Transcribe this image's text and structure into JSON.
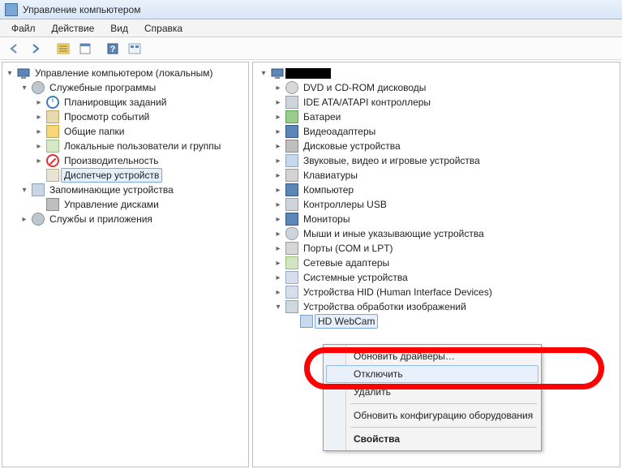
{
  "window": {
    "title": "Управление компьютером"
  },
  "menubar": [
    "Файл",
    "Действие",
    "Вид",
    "Справка"
  ],
  "left_tree": {
    "root": {
      "label": "Управление компьютером (локальным)"
    },
    "groups": [
      {
        "label": "Служебные программы",
        "expanded": true,
        "children": [
          {
            "label": "Планировщик заданий",
            "icon": "clock"
          },
          {
            "label": "Просмотр событий",
            "icon": "event"
          },
          {
            "label": "Общие папки",
            "icon": "share"
          },
          {
            "label": "Локальные пользователи и группы",
            "icon": "users"
          },
          {
            "label": "Производительность",
            "icon": "no"
          },
          {
            "label": "Диспетчер устройств",
            "icon": "dev",
            "selected": true
          }
        ]
      },
      {
        "label": "Запоминающие устройства",
        "expanded": true,
        "children": [
          {
            "label": "Управление дисками",
            "icon": "disk"
          }
        ]
      },
      {
        "label": "Службы и приложения",
        "expanded": false
      }
    ]
  },
  "right_tree": {
    "categories": [
      {
        "label": "DVD и CD-ROM дисководы",
        "icon": "cd"
      },
      {
        "label": "IDE ATA/ATAPI контроллеры",
        "icon": "chip"
      },
      {
        "label": "Батареи",
        "icon": "bat"
      },
      {
        "label": "Видеоадаптеры",
        "icon": "mon"
      },
      {
        "label": "Дисковые устройства",
        "icon": "disk"
      },
      {
        "label": "Звуковые, видео и игровые устройства",
        "icon": "aud"
      },
      {
        "label": "Клавиатуры",
        "icon": "kb"
      },
      {
        "label": "Компьютер",
        "icon": "mon"
      },
      {
        "label": "Контроллеры USB",
        "icon": "usb"
      },
      {
        "label": "Мониторы",
        "icon": "mon"
      },
      {
        "label": "Мыши и иные указывающие устройства",
        "icon": "mouse"
      },
      {
        "label": "Порты (COM и LPT)",
        "icon": "port"
      },
      {
        "label": "Сетевые адаптеры",
        "icon": "net"
      },
      {
        "label": "Системные устройства",
        "icon": "sys"
      },
      {
        "label": "Устройства HID (Human Interface Devices)",
        "icon": "hid"
      }
    ],
    "expanded_category": {
      "label": "Устройства обработки изображений",
      "icon": "img",
      "child": {
        "label": "HD WebCam",
        "icon": "cam",
        "selected": true
      }
    }
  },
  "context_menu": {
    "items": [
      {
        "label": "Обновить драйверы…"
      },
      {
        "label": "Отключить",
        "highlighted": true
      },
      {
        "label": "Удалить"
      }
    ],
    "sep1": true,
    "items2": [
      {
        "label": "Обновить конфигурацию оборудования"
      }
    ],
    "sep2": true,
    "items3": [
      {
        "label": "Свойства",
        "bold": true
      }
    ]
  }
}
